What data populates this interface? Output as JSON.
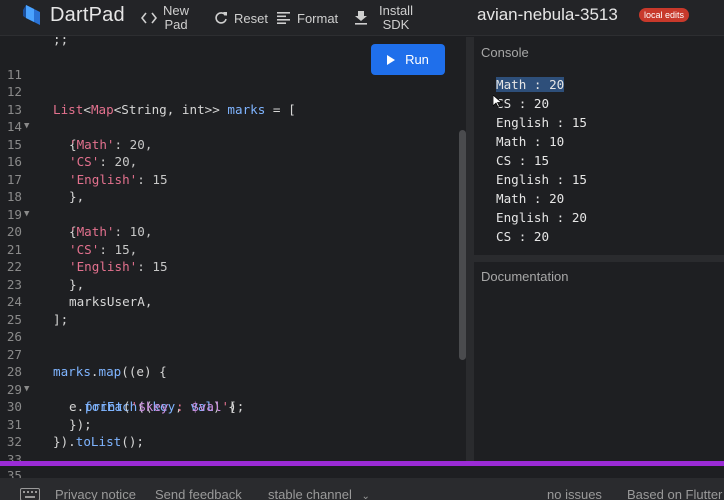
{
  "header": {
    "brand": "DartPad",
    "new_pad_line1": "New",
    "new_pad_line2": "Pad",
    "reset_label": "Reset",
    "format_label": "Format",
    "install_line1": "Install",
    "install_line2": "SDK",
    "project_name": "avian-nebula-3513",
    "badge": "local edits"
  },
  "editor": {
    "run_label": "Run",
    "lines": [
      {
        "n": "11",
        "fold": false
      },
      {
        "n": "12",
        "fold": false
      },
      {
        "n": "13",
        "fold": true
      },
      {
        "n": "14",
        "fold": false
      },
      {
        "n": "15",
        "fold": false
      },
      {
        "n": "16",
        "fold": false
      },
      {
        "n": "17",
        "fold": false
      },
      {
        "n": "18",
        "fold": true
      },
      {
        "n": "19",
        "fold": false
      },
      {
        "n": "20",
        "fold": false
      },
      {
        "n": "21",
        "fold": false
      },
      {
        "n": "22",
        "fold": false
      },
      {
        "n": "23",
        "fold": false
      },
      {
        "n": "24",
        "fold": false
      },
      {
        "n": "25",
        "fold": false
      },
      {
        "n": "26",
        "fold": false
      },
      {
        "n": "27",
        "fold": false
      },
      {
        "n": "28",
        "fold": true
      },
      {
        "n": "29",
        "fold": false
      },
      {
        "n": "30",
        "fold": false
      },
      {
        "n": "31",
        "fold": false
      },
      {
        "n": "32",
        "fold": false
      },
      {
        "n": "33",
        "fold": false
      }
    ],
    "code": {
      "l12_list": "List",
      "l12_lt": "<",
      "l12_map": "Map",
      "l12_rest": "<String, int>> ",
      "l12_marks": "marks",
      "l12_end": " = [",
      "l13": "{",
      "l14_key": "'Math'",
      "l14_val": ": 20,",
      "l15_key": "'CS'",
      "l15_val": ": 20,",
      "l16_key": "'English'",
      "l16_val": ": 15",
      "l17": "},",
      "l18": "{",
      "l19_key": "'Math'",
      "l19_val": ": 10,",
      "l20_key": "'CS'",
      "l20_val": ": 15,",
      "l21_key": "'English'",
      "l21_val": ": 15",
      "l22": "},",
      "l23": "marksUserA,",
      "l24": "];",
      "l27_marks": "marks",
      "l27_dot": ".",
      "l27_map": "map",
      "l27_rest": "((e) {",
      "l28_e": "e.",
      "l28_fe": "forEach",
      "l28_p1": "((",
      "l28_key": "key",
      "l28_c": ", ",
      "l28_val": "val",
      "l28_end": ") {",
      "l29_print": "print",
      "l29_p": "(",
      "l29_q1": "'",
      "l29_dk": "$key",
      "l29_mid": " : ",
      "l29_dv": "$val",
      "l29_q2": "'",
      "l29_end": ");",
      "l30": "});",
      "l31_a": "}).",
      "l31_tl": "toList",
      "l31_end": "();",
      "l33": "}",
      "l35": "35"
    }
  },
  "console": {
    "title": "Console",
    "lines": [
      "Math : 20",
      "CS : 20",
      "English : 15",
      "Math : 10",
      "CS : 15",
      "English : 15",
      "Math : 20",
      "English : 20",
      "CS : 20"
    ]
  },
  "docs": {
    "title": "Documentation"
  },
  "footer": {
    "privacy": "Privacy notice",
    "feedback": "Send feedback",
    "channel": "stable channel",
    "issues": "no issues",
    "based": "Based on Flutter"
  },
  "colors": {
    "accent": "#1f6feb",
    "badge": "#c8392b",
    "divider": "#9b2bd6"
  }
}
